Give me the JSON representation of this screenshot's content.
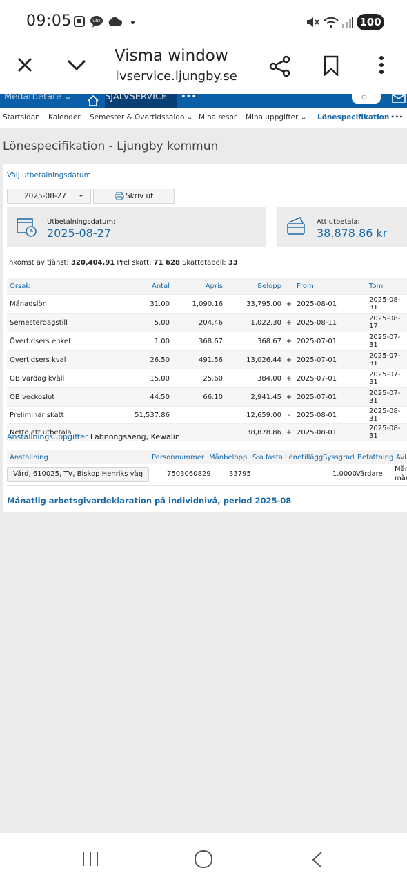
{
  "status": {
    "time": "09:05",
    "battery": "100"
  },
  "browser": {
    "title": "Visma window",
    "url_prefix": "l",
    "url_main": "vservice.ljungby.se"
  },
  "sitenav": {
    "employee_menu": "Medarbetare",
    "selfservice": "SJÄLVSERVICE",
    "more": "•••"
  },
  "subnav": [
    {
      "label": "Startsidan"
    },
    {
      "label": "Kalender"
    },
    {
      "label": "Semester & Övertidssaldo ⌄"
    },
    {
      "label": "Mina resor"
    },
    {
      "label": "Mina uppgifter ⌄"
    },
    {
      "label": "Lönespecifikation"
    },
    {
      "label": "•••"
    }
  ],
  "page": {
    "heading": "Lönespecifikation - Ljungby kommun",
    "choose_date_label": "Välj utbetalningsdatum",
    "selected_date": "2025-08-27",
    "print_label": "Skriv ut",
    "payout_date_label": "Utbetalningsdatum:",
    "payout_date_value": "2025-08-27",
    "to_pay_label": "Att utbetala:",
    "to_pay_value": "38,878.86 kr",
    "income_prefix": "Inkomst av tjänst: ",
    "income_value": "320,404.91",
    "prel_prefix": " Prel skatt: ",
    "prel_value": "71 628",
    "table_prefix": " Skattetabell: ",
    "table_value": "33"
  },
  "pay_table": {
    "headers": [
      "Orsak",
      "Antal",
      "Apris",
      "Belopp",
      "",
      "From",
      "Tom"
    ],
    "rows": [
      [
        "Månadslön",
        "31.00",
        "1,090.16",
        "33,795.00",
        "+",
        "2025-08-01",
        "2025-08-31"
      ],
      [
        "Semesterdagstill",
        "5.00",
        "204.46",
        "1,022.30",
        "+",
        "2025-08-11",
        "2025-08-17"
      ],
      [
        "Övertidsers enkel",
        "1.00",
        "368.67",
        "368.67",
        "+",
        "2025-07-01",
        "2025-07-31"
      ],
      [
        "Övertidsers kval",
        "26.50",
        "491.56",
        "13,026.44",
        "+",
        "2025-07-01",
        "2025-07-31"
      ],
      [
        "OB vardag kväll",
        "15.00",
        "25.60",
        "384.00",
        "+",
        "2025-07-01",
        "2025-07-31"
      ],
      [
        "OB veckoslut",
        "44.50",
        "66.10",
        "2,941.45",
        "+",
        "2025-07-01",
        "2025-07-31"
      ],
      [
        "Preliminär skatt",
        "51,537.86",
        "",
        "12,659.00",
        "-",
        "2025-08-01",
        "2025-08-31"
      ],
      [
        "Netto att utbetala",
        "",
        "",
        "38,878.86",
        "+",
        "2025-08-01",
        "2025-08-31"
      ]
    ]
  },
  "employment": {
    "title_link": "Anställningsuppgifter",
    "name": "Labnongsaeng, Kewalin",
    "headers": [
      "Anställning",
      "Personnummer",
      "Månbelopp",
      "S:a fasta Lönetillägg",
      "Syssgrad",
      "Befattning",
      "Avl"
    ],
    "select_value": "Vård, 610025, TV, Biskop Henriks väg",
    "personnummer": "7503060829",
    "manbelopp": "33795",
    "syssgrad": "1.0000",
    "befattning": "Vårdare",
    "avl_line1": "Mån",
    "avl_line2": "mån"
  },
  "declaration_link": "Månatlig arbetsgivardeklaration på individnivå, period 2025-08"
}
